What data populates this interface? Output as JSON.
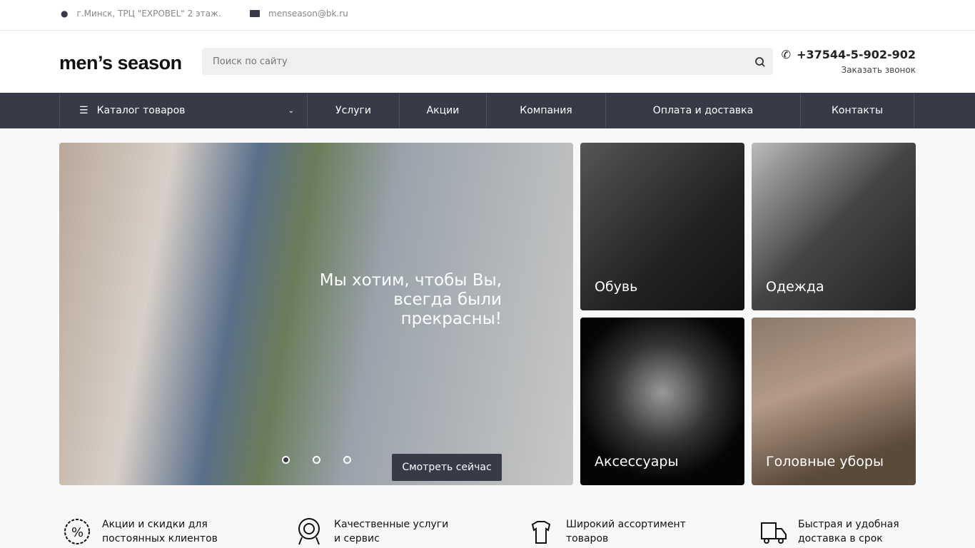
{
  "topbar": {
    "address": "г.Минск, ТРЦ \"EXPOBEL\" 2 этаж.",
    "email": "menseason@bk.ru"
  },
  "header": {
    "logo": "men’s season",
    "search_placeholder": "Поиск по сайту",
    "phone": "+37544-5-902-902",
    "callback": "Заказать звонок"
  },
  "nav": {
    "catalog": "Каталог товаров",
    "items": [
      "Услуги",
      "Акции",
      "Компания",
      "Оплата и доставка",
      "Контакты"
    ]
  },
  "slider": {
    "caption": "Мы хотим, чтобы Вы, всегда были прекрасны!",
    "button": "Смотреть сейчас",
    "active_slide": 1,
    "slides": 3
  },
  "tiles": [
    "Обувь",
    "Одежда",
    "Аксессуары",
    "Головные уборы"
  ],
  "features": [
    "Акции и скидки для постоянных клиентов",
    "Качественные услуги и сервис",
    "Широкий ассортимент товаров",
    "Быстрая и удобная доставка в срок"
  ]
}
